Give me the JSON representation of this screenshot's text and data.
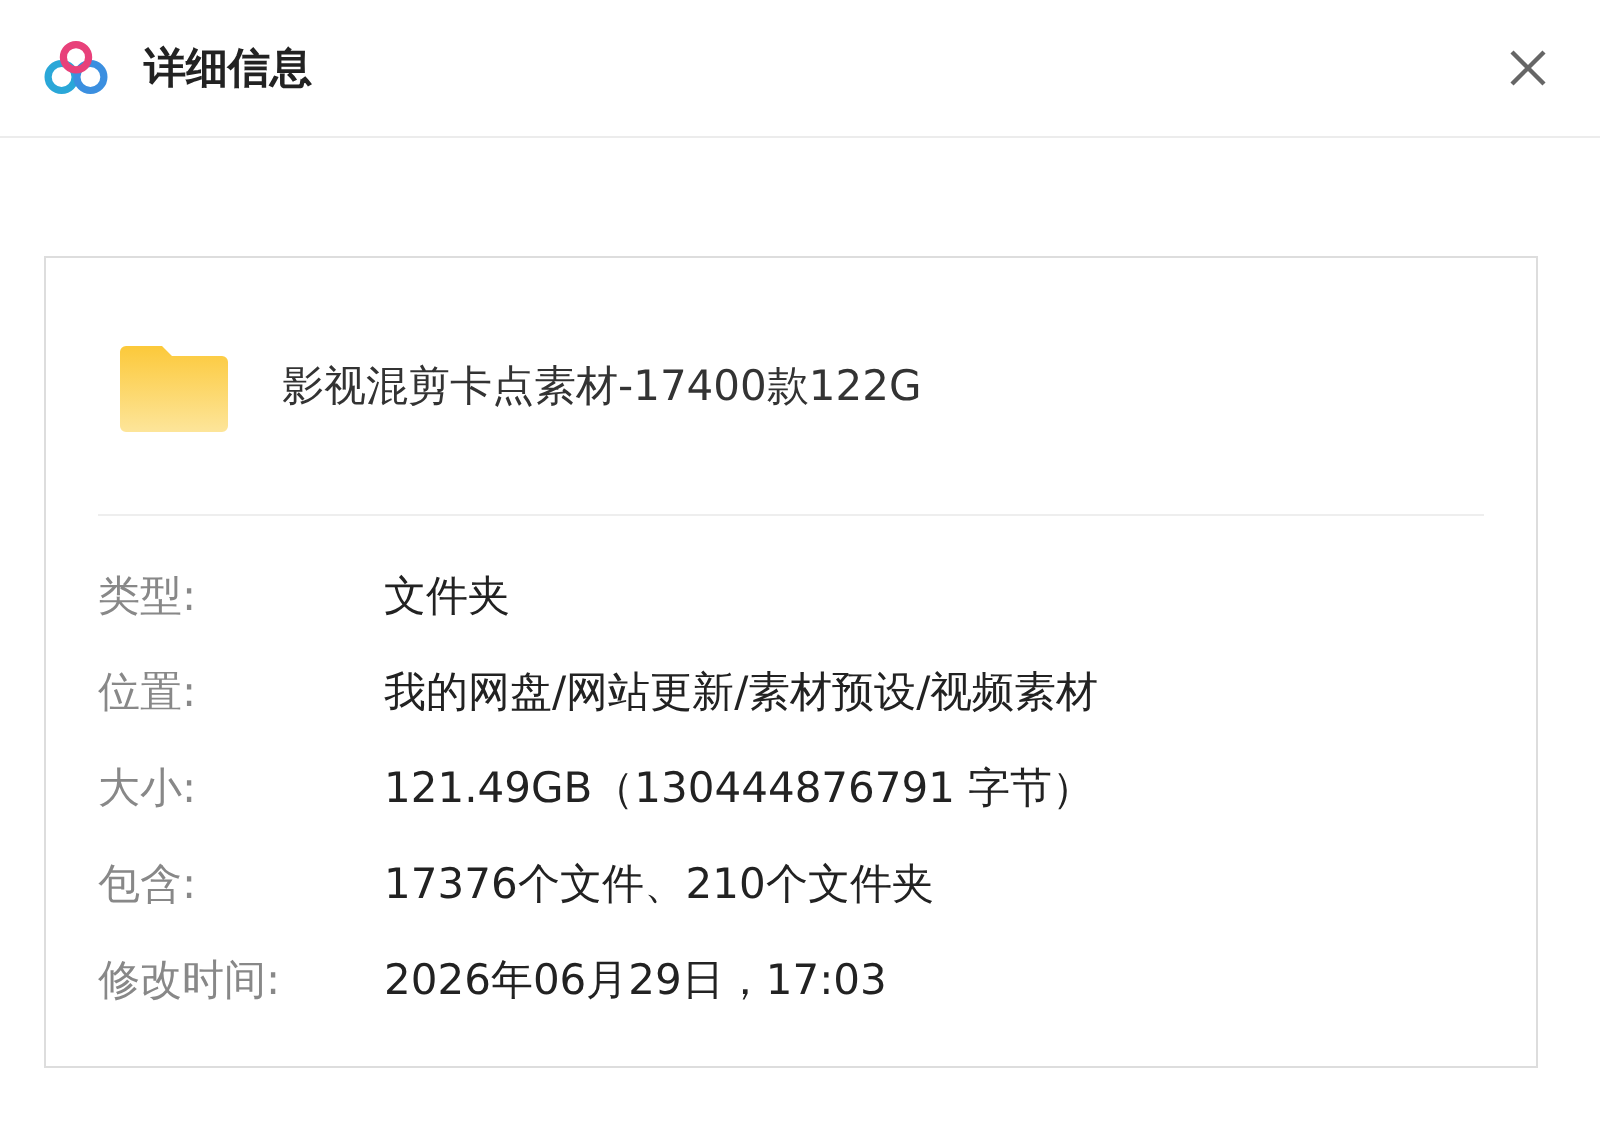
{
  "window": {
    "title": "详细信息"
  },
  "file": {
    "name": "影视混剪卡点素材-17400款122G"
  },
  "details": [
    {
      "label": "类型:",
      "value": "文件夹"
    },
    {
      "label": "位置:",
      "value": "我的网盘/网站更新/素材预设/视频素材"
    },
    {
      "label": "大小:",
      "value": "121.49GB（130444876791 字节）"
    },
    {
      "label": "包含:",
      "value": "17376个文件、210个文件夹"
    },
    {
      "label": "修改时间:",
      "value": "2026年06月29日，17:03"
    }
  ]
}
